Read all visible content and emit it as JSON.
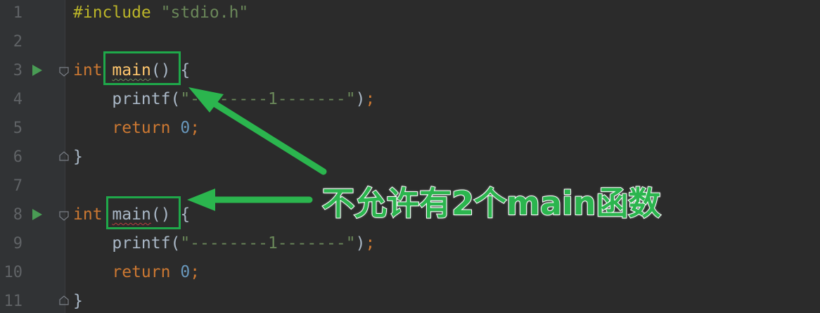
{
  "editor": {
    "lines": [
      {
        "num": "1",
        "tokens": [
          [
            "pp",
            "#include"
          ],
          [
            "plain",
            " "
          ],
          [
            "str",
            "\"stdio.h\""
          ]
        ]
      },
      {
        "num": "2",
        "tokens": []
      },
      {
        "num": "3",
        "tokens": [
          [
            "kw",
            "int"
          ],
          [
            "plain",
            " "
          ],
          [
            "fn",
            "main"
          ],
          [
            "plain",
            "() {"
          ]
        ],
        "run": true,
        "fold": "open",
        "squiggle": "main",
        "squiggle_color": "#6a8759"
      },
      {
        "num": "4",
        "tokens": [
          [
            "plain",
            "    printf("
          ],
          [
            "str",
            "\"--------1-------\""
          ],
          [
            "plain",
            ")"
          ],
          [
            "kw",
            ";"
          ]
        ]
      },
      {
        "num": "5",
        "tokens": [
          [
            "plain",
            "    "
          ],
          [
            "kw",
            "return"
          ],
          [
            "plain",
            " "
          ],
          [
            "num",
            "0"
          ],
          [
            "kw",
            ";"
          ]
        ]
      },
      {
        "num": "6",
        "tokens": [
          [
            "plain",
            "}"
          ]
        ],
        "fold": "close"
      },
      {
        "num": "7",
        "tokens": []
      },
      {
        "num": "8",
        "tokens": [
          [
            "kw",
            "int"
          ],
          [
            "plain",
            " "
          ],
          [
            "plain",
            "main"
          ],
          [
            "plain",
            "() {"
          ]
        ],
        "run": true,
        "fold": "open",
        "squiggle": "main",
        "squiggle_color": "#bc3f3c"
      },
      {
        "num": "9",
        "tokens": [
          [
            "plain",
            "    printf("
          ],
          [
            "str",
            "\"--------1-------\""
          ],
          [
            "plain",
            ")"
          ],
          [
            "kw",
            ";"
          ]
        ]
      },
      {
        "num": "10",
        "tokens": [
          [
            "plain",
            "    "
          ],
          [
            "kw",
            "return"
          ],
          [
            "plain",
            " "
          ],
          [
            "num",
            "0"
          ],
          [
            "kw",
            ";"
          ]
        ]
      },
      {
        "num": "11",
        "tokens": [
          [
            "plain",
            "}"
          ]
        ],
        "fold": "close"
      }
    ]
  },
  "annotation": {
    "text": "不允许有2个main函数",
    "color": "#2bb54e"
  },
  "icons": {
    "run": "run-gutter-icon",
    "fold": "fold-marker-icon",
    "arrow": "arrow-icon"
  }
}
